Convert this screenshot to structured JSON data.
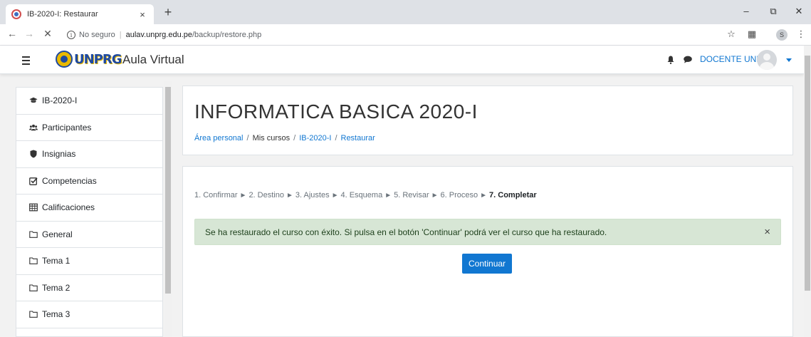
{
  "browser": {
    "tab_title": "IB-2020-I: Restaurar",
    "tab_close": "×",
    "new_tab": "+",
    "window_controls": [
      "–",
      "⧉",
      "✕"
    ],
    "security_text": "No seguro",
    "url_host": "aulav.unprg.edu.pe",
    "url_path": "/backup/restore.php",
    "profile_initial": "S"
  },
  "navbar": {
    "logo_text": "UNPRG",
    "site_name": "Aula Virtual",
    "user_name": "DOCENTE UNPRG"
  },
  "drawer": {
    "items": [
      {
        "label": "IB-2020-I",
        "icon": "graduation-cap-icon"
      },
      {
        "label": "Participantes",
        "icon": "users-icon"
      },
      {
        "label": "Insignias",
        "icon": "shield-icon"
      },
      {
        "label": "Competencias",
        "icon": "checkbox-icon"
      },
      {
        "label": "Calificaciones",
        "icon": "table-icon"
      },
      {
        "label": "General",
        "icon": "folder-icon"
      },
      {
        "label": "Tema 1",
        "icon": "folder-icon"
      },
      {
        "label": "Tema 2",
        "icon": "folder-icon"
      },
      {
        "label": "Tema 3",
        "icon": "folder-icon"
      }
    ]
  },
  "header": {
    "course_title": "INFORMATICA BASICA 2020-I",
    "breadcrumb": [
      "Área personal",
      "Mis cursos",
      "IB-2020-I",
      "Restaurar"
    ]
  },
  "restore": {
    "steps": [
      "1. Confirmar",
      "2. Destino",
      "3. Ajustes",
      "4. Esquema",
      "5. Revisar",
      "6. Proceso",
      "7. Completar"
    ],
    "current_step_index": 6,
    "alert_message": "Se ha restaurado el curso con éxito. Si pulsa en el botón 'Continuar' podrá ver el curso que ha restaurado.",
    "continue_label": "Continuar"
  },
  "colors": {
    "link": "#1177d1",
    "alert_bg": "#d7e6d5",
    "primary_button": "#1177d1"
  }
}
